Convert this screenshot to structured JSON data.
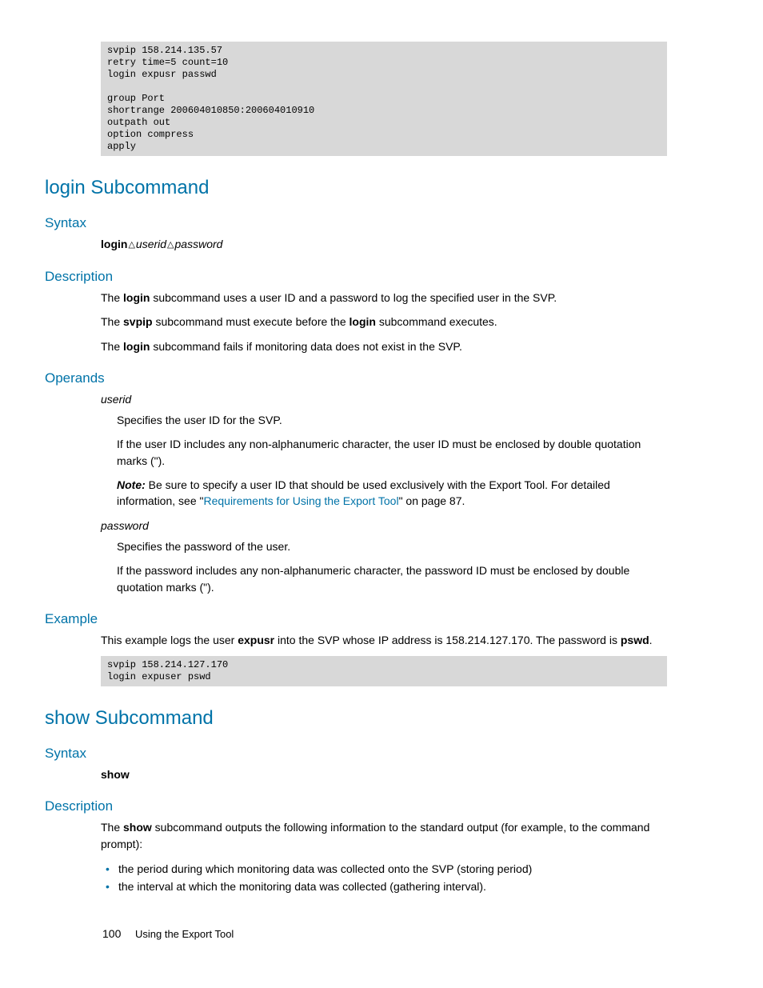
{
  "code1": "svpip 158.214.135.57\nretry time=5 count=10\nlogin expusr passwd\n\ngroup Port\nshortrange 200604010850:200604010910\noutpath out\noption compress\napply",
  "login": {
    "heading": "login Subcommand",
    "syntax_h": "Syntax",
    "syntax_login": "login",
    "syntax_userid": "userid",
    "syntax_password": "password",
    "desc_h": "Description",
    "d1a": "The ",
    "d1b": "login",
    "d1c": " subcommand uses a user ID and a password to log the specified user in the SVP.",
    "d2a": "The ",
    "d2b": "svpip",
    "d2c": " subcommand must execute before the ",
    "d2d": "login",
    "d2e": " subcommand executes.",
    "d3a": "The ",
    "d3b": "login",
    "d3c": " subcommand fails if monitoring data does not exist in the SVP.",
    "oper_h": "Operands",
    "op_userid": "userid",
    "op_u1": "Specifies the user ID for the SVP.",
    "op_u2": "If the user ID includes any non-alphanumeric character, the user ID must be enclosed by double quotation marks (\").",
    "op_note_b": "Note:",
    "op_note_t1": " Be sure to specify a user ID that should be used exclusively with the Export Tool. For detailed information, see \"",
    "op_note_link": "Requirements for Using the Export Tool",
    "op_note_t2": "\" on page 87.",
    "op_password": "password",
    "op_p1": "Specifies the password of the user.",
    "op_p2": "If the password includes any non-alphanumeric character, the password ID must be enclosed by double quotation marks (\").",
    "ex_h": "Example",
    "ex_t1": "This example logs the user ",
    "ex_b1": "expusr",
    "ex_t2": " into the SVP whose IP address is 158.214.127.170. The password is ",
    "ex_b2": "pswd",
    "ex_t3": "."
  },
  "code2": "svpip 158.214.127.170\nlogin expuser pswd",
  "show": {
    "heading": "show Subcommand",
    "syntax_h": "Syntax",
    "syntax_v": "show",
    "desc_h": "Description",
    "d1a": "The ",
    "d1b": "show",
    "d1c": " subcommand outputs the following information to the standard output (for example, to the command prompt):",
    "li1": "the period during which monitoring data was collected onto the SVP (storing period)",
    "li2": "the interval at which the monitoring data was collected (gathering interval)."
  },
  "footer": {
    "page": "100",
    "text": "Using the Export Tool"
  }
}
